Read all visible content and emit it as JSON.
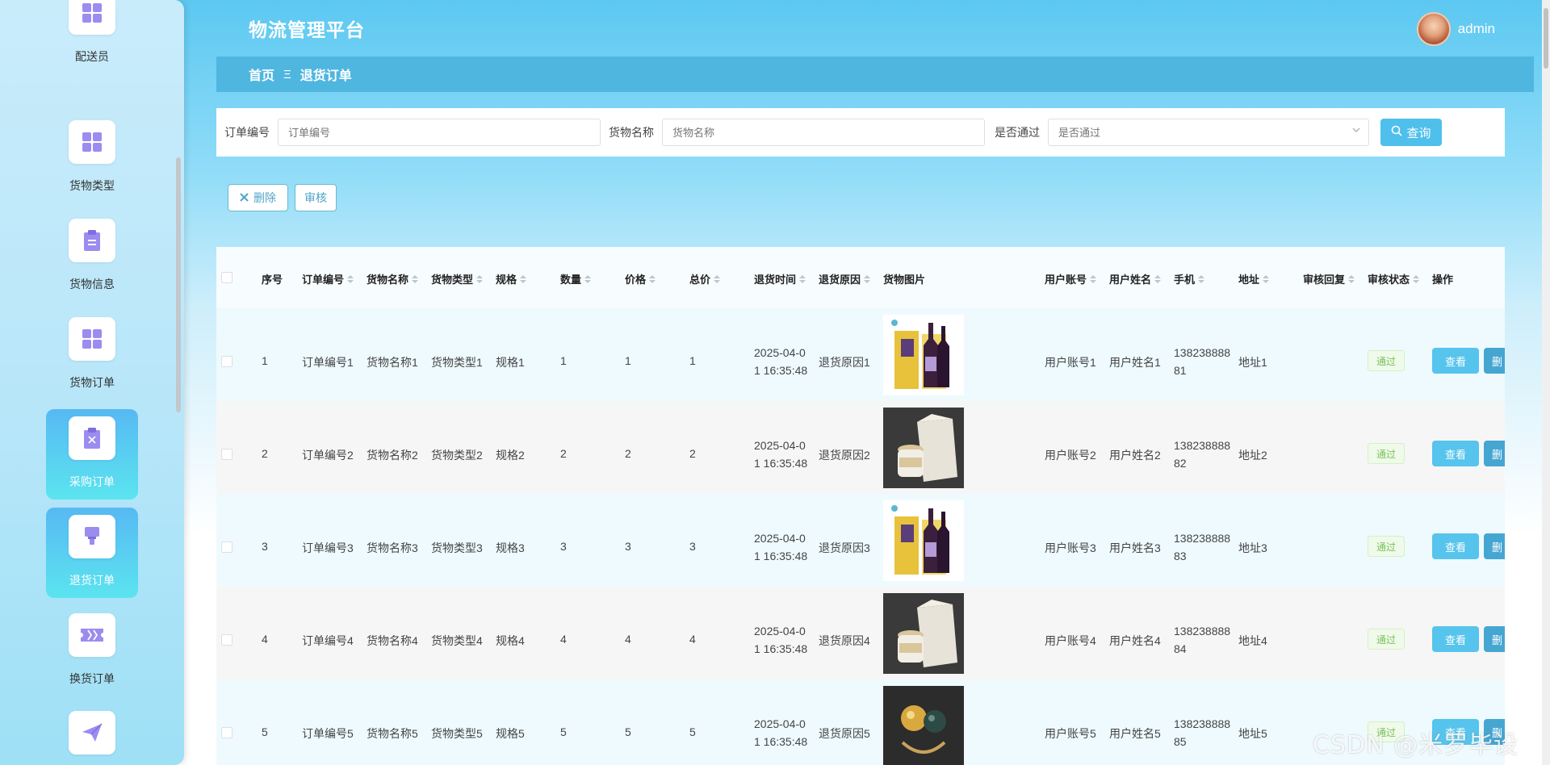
{
  "header": {
    "app_title": "物流管理平台",
    "username": "admin"
  },
  "breadcrumb": {
    "home": "首页",
    "separator": "Ξ",
    "current": "退货订单"
  },
  "sidebar": {
    "items": [
      {
        "label": "配送员",
        "icon": "grid-icon"
      },
      {
        "label": "货物类型",
        "icon": "grid-icon"
      },
      {
        "label": "货物信息",
        "icon": "clipboard-icon"
      },
      {
        "label": "货物订单",
        "icon": "grid-icon"
      },
      {
        "label": "采购订单",
        "icon": "clipboard-x-icon"
      },
      {
        "label": "退货订单",
        "icon": "brush-icon",
        "active": true
      },
      {
        "label": "换货订单",
        "icon": "ticket-icon"
      },
      {
        "label": "",
        "icon": "paper-plane-icon"
      }
    ]
  },
  "search": {
    "order_no_label": "订单编号",
    "order_no_placeholder": "订单编号",
    "goods_name_label": "货物名称",
    "goods_name_placeholder": "货物名称",
    "passed_label": "是否通过",
    "passed_placeholder": "是否通过",
    "search_button": "查询"
  },
  "actions": {
    "delete_button": "删除",
    "audit_button": "审核"
  },
  "table": {
    "headers": [
      "序号",
      "订单编号",
      "货物名称",
      "货物类型",
      "规格",
      "数量",
      "价格",
      "总价",
      "退货时间",
      "退货原因",
      "货物图片",
      "用户账号",
      "用户姓名",
      "手机",
      "地址",
      "审核回复",
      "审核状态",
      "操作"
    ],
    "rows": [
      {
        "index": "1",
        "order_no": "订单编号1",
        "goods_name": "货物名称1",
        "goods_type": "货物类型1",
        "spec": "规格1",
        "qty": "1",
        "price": "1",
        "total": "1",
        "time_1": "2025-04-0",
        "time_2": "1 16:35:48",
        "reason": "退货原因1",
        "image": "wine-gift-box",
        "account": "用户账号1",
        "name": "用户姓名1",
        "phone_1": "138238888",
        "phone_2": "81",
        "address": "地址1",
        "reply": "",
        "status": "通过"
      },
      {
        "index": "2",
        "order_no": "订单编号2",
        "goods_name": "货物名称2",
        "goods_type": "货物类型2",
        "spec": "规格2",
        "qty": "2",
        "price": "2",
        "total": "2",
        "time_1": "2025-04-0",
        "time_2": "1 16:35:48",
        "reason": "退货原因2",
        "image": "jar-with-box",
        "account": "用户账号2",
        "name": "用户姓名2",
        "phone_1": "138238888",
        "phone_2": "82",
        "address": "地址2",
        "reply": "",
        "status": "通过"
      },
      {
        "index": "3",
        "order_no": "订单编号3",
        "goods_name": "货物名称3",
        "goods_type": "货物类型3",
        "spec": "规格3",
        "qty": "3",
        "price": "3",
        "total": "3",
        "time_1": "2025-04-0",
        "time_2": "1 16:35:48",
        "reason": "退货原因3",
        "image": "wine-gift-box",
        "account": "用户账号3",
        "name": "用户姓名3",
        "phone_1": "138238888",
        "phone_2": "83",
        "address": "地址3",
        "reply": "",
        "status": "通过"
      },
      {
        "index": "4",
        "order_no": "订单编号4",
        "goods_name": "货物名称4",
        "goods_type": "货物类型4",
        "spec": "规格4",
        "qty": "4",
        "price": "4",
        "total": "4",
        "time_1": "2025-04-0",
        "time_2": "1 16:35:48",
        "reason": "退货原因4",
        "image": "jar-with-box",
        "account": "用户账号4",
        "name": "用户姓名4",
        "phone_1": "138238888",
        "phone_2": "84",
        "address": "地址4",
        "reply": "",
        "status": "通过"
      },
      {
        "index": "5",
        "order_no": "订单编号5",
        "goods_name": "货物名称5",
        "goods_type": "货物类型5",
        "spec": "规格5",
        "qty": "5",
        "price": "5",
        "total": "5",
        "time_1": "2025-04-0",
        "time_2": "1 16:35:48",
        "reason": "退货原因5",
        "image": "pearl-ring",
        "account": "用户账号5",
        "name": "用户姓名5",
        "phone_1": "138238888",
        "phone_2": "85",
        "address": "地址5",
        "reply": "",
        "status": "通过"
      }
    ],
    "view_button": "查看",
    "more_button": "删"
  },
  "watermark": "CSDN @米罗毕设",
  "colors": {
    "primary": "#4fbfec",
    "breadcrumb_bg": "#4fb6e0",
    "active_menu_top": "#57b9f3",
    "active_menu_bottom": "#5be4ef",
    "menu_icon": "#9b8cf0",
    "status_green": "#7ac15a"
  }
}
